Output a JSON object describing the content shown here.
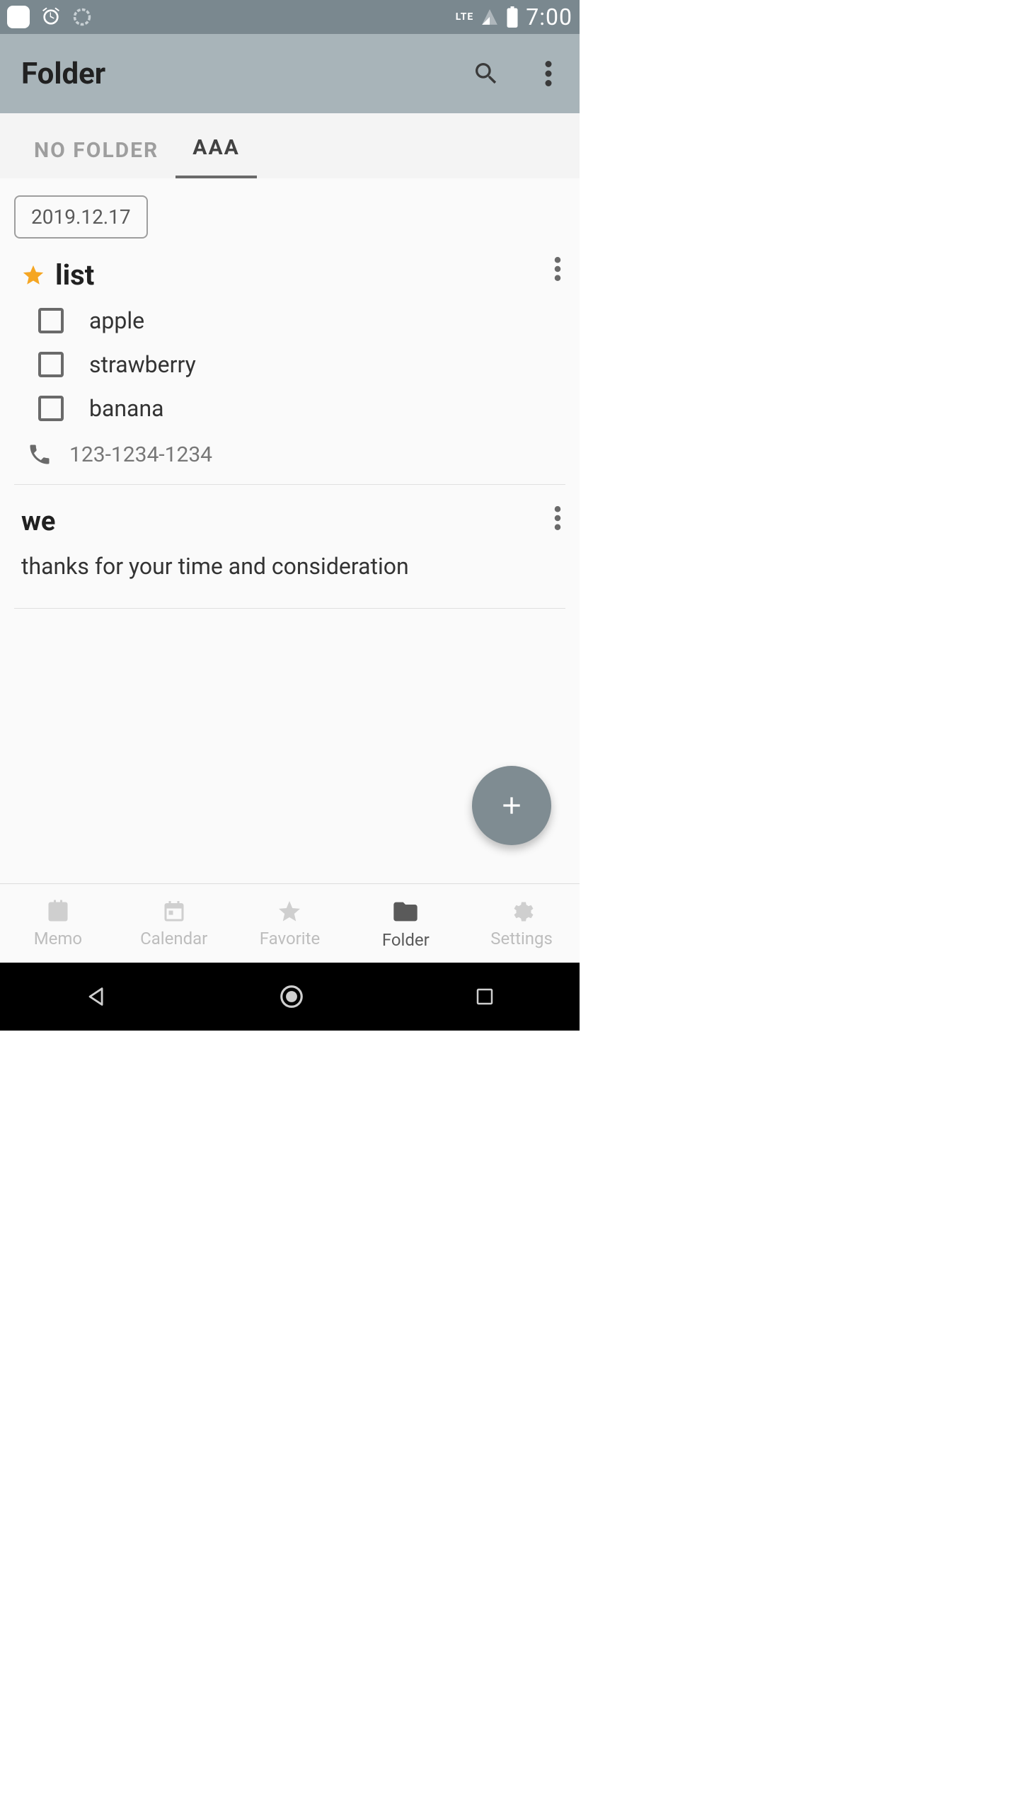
{
  "status": {
    "time": "7:00",
    "lte": "LTE"
  },
  "appbar": {
    "title": "Folder"
  },
  "tabs": {
    "items": [
      {
        "label": "NO FOLDER",
        "active": false
      },
      {
        "label": "AAA",
        "active": true
      }
    ]
  },
  "date_chip": "2019.12.17",
  "notes": [
    {
      "title": "list",
      "starred": true,
      "checklist": [
        {
          "label": "apple",
          "checked": false
        },
        {
          "label": "strawberry",
          "checked": false
        },
        {
          "label": "banana",
          "checked": false
        }
      ],
      "phone": "123-1234-1234"
    },
    {
      "title": "we",
      "body": "thanks for your time and consideration"
    }
  ],
  "bottom_nav": {
    "items": [
      {
        "label": "Memo"
      },
      {
        "label": "Calendar"
      },
      {
        "label": "Favorite"
      },
      {
        "label": "Folder"
      },
      {
        "label": "Settings"
      }
    ],
    "active_index": 3
  }
}
